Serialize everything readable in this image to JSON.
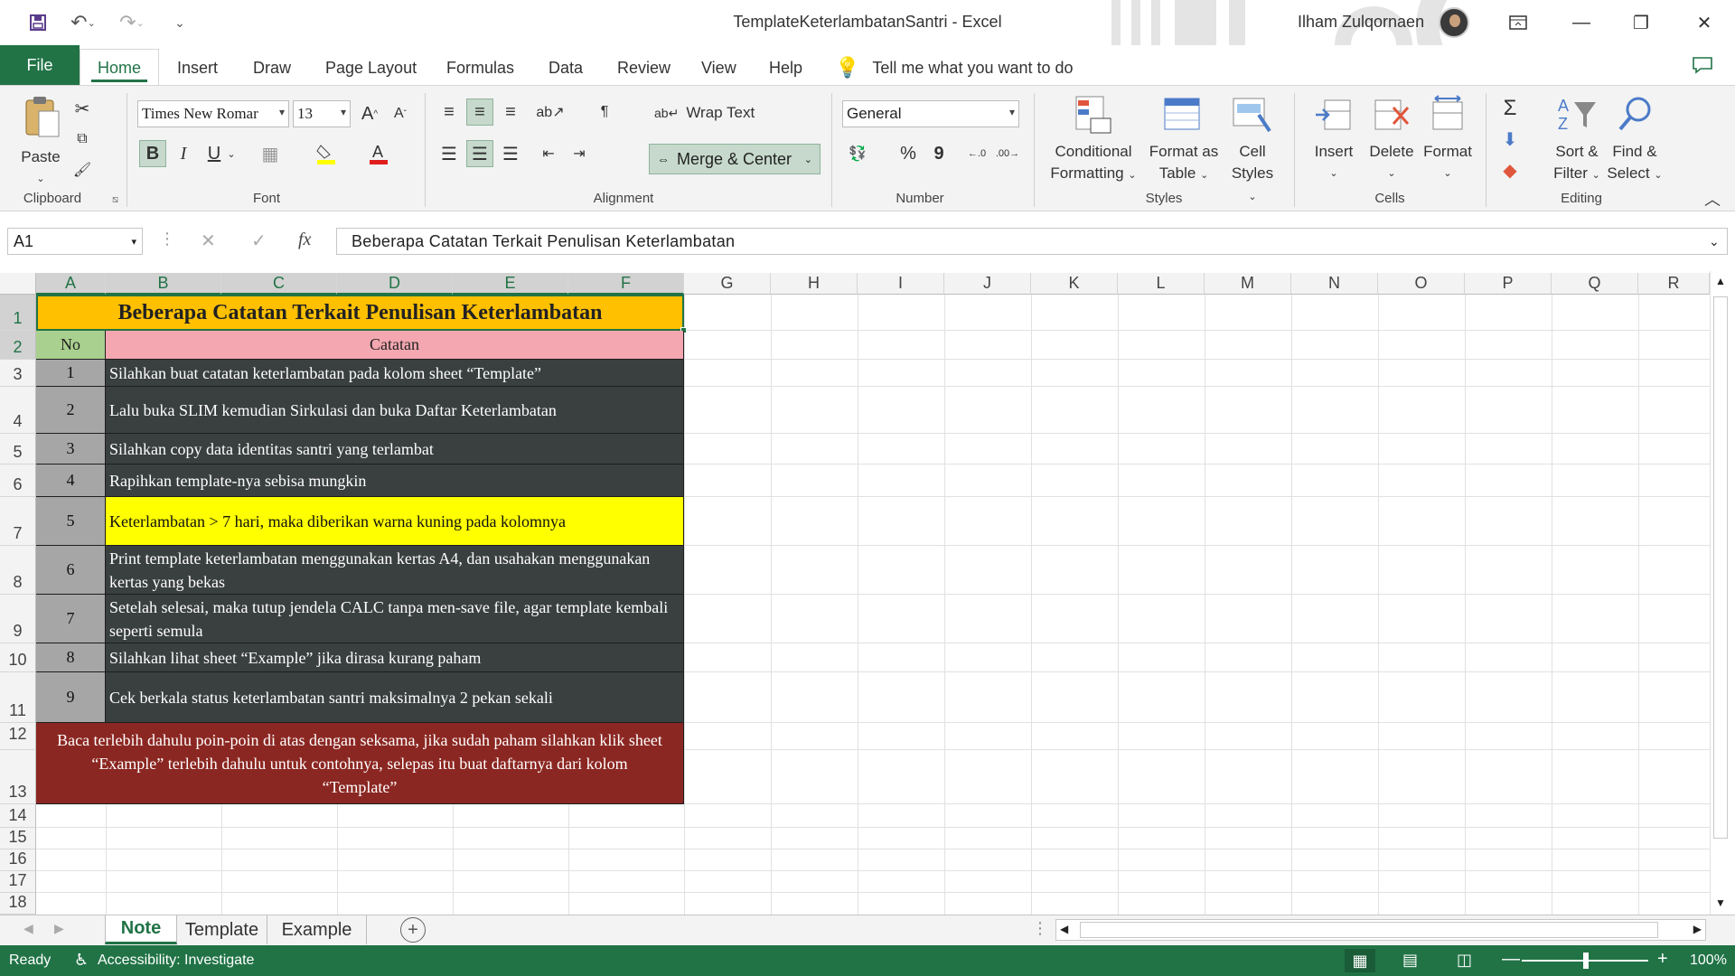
{
  "titlebar": {
    "title": "TemplateKeterlambatanSantri  -  Excel",
    "user": "Ilham Zulqornaen",
    "save_icon": "save-icon",
    "undo_icon": "undo-icon",
    "redo_icon": "redo-icon"
  },
  "tabs": [
    "File",
    "Home",
    "Insert",
    "Draw",
    "Page Layout",
    "Formulas",
    "Data",
    "Review",
    "View",
    "Help"
  ],
  "tell_me": "Tell me what you want to do",
  "ribbon": {
    "clipboard": {
      "paste": "Paste",
      "label": "Clipboard"
    },
    "font": {
      "name": "Times New Romar",
      "size": "13",
      "label": "Font",
      "bold": "B",
      "italic": "I",
      "underline": "U"
    },
    "alignment": {
      "wrap": "Wrap Text",
      "merge": "Merge & Center",
      "label": "Alignment"
    },
    "number": {
      "format": "General",
      "label": "Number",
      "percent": "%",
      "comma": "9"
    },
    "styles": {
      "conditional": "Conditional",
      "conditional2": "Formatting",
      "format_table": "Format as",
      "format_table2": "Table",
      "cell_styles": "Cell",
      "cell_styles2": "Styles",
      "label": "Styles"
    },
    "cells": {
      "insert": "Insert",
      "delete": "Delete",
      "format": "Format",
      "label": "Cells"
    },
    "editing": {
      "sort": "Sort &",
      "sort2": "Filter",
      "find": "Find &",
      "find2": "Select",
      "label": "Editing"
    }
  },
  "formula_bar": {
    "name_box": "A1",
    "fx": "fx",
    "content": "Beberapa Catatan Terkait Penulisan Keterlambatan"
  },
  "columns": [
    "A",
    "B",
    "C",
    "D",
    "E",
    "F",
    "G",
    "H",
    "I",
    "J",
    "K",
    "L",
    "M",
    "N",
    "O",
    "P",
    "Q",
    "R"
  ],
  "rows": [
    "1",
    "2",
    "3",
    "4",
    "5",
    "6",
    "7",
    "8",
    "9",
    "10",
    "11",
    "12",
    "13",
    "14",
    "15",
    "16",
    "17",
    "18"
  ],
  "sheet": {
    "title": "Beberapa Catatan Terkait Penulisan Keterlambatan",
    "header_no": "No",
    "header_note": "Catatan",
    "notes": [
      {
        "no": "1",
        "text": "Silahkan buat catatan keterlambatan pada kolom sheet “Template”"
      },
      {
        "no": "2",
        "text": "Lalu buka SLIM kemudian Sirkulasi dan buka Daftar Keterlambatan"
      },
      {
        "no": "3",
        "text": "Silahkan copy data identitas santri yang terlambat"
      },
      {
        "no": "4",
        "text": "Rapihkan template-nya sebisa mungkin"
      },
      {
        "no": "5",
        "text": "Keterlambatan > 7 hari, maka diberikan warna kuning pada kolomnya"
      },
      {
        "no": "6",
        "text": "Print template keterlambatan menggunakan kertas A4, dan usahakan menggunakan kertas yang bekas"
      },
      {
        "no": "7",
        "text": "Setelah selesai, maka tutup jendela CALC tanpa men-save file, agar template kembali seperti semula"
      },
      {
        "no": "8",
        "text": "Silahkan lihat sheet “Example” jika dirasa kurang paham"
      },
      {
        "no": "9",
        "text": "Cek berkala status keterlambatan santri maksimalnya 2 pekan sekali"
      }
    ],
    "footer": "Baca terlebih dahulu poin-poin di atas dengan seksama, jika sudah paham silahkan klik sheet “Example” terlebih dahulu untuk contohnya, selepas itu buat daftarnya dari kolom “Template”"
  },
  "sheet_tabs": [
    "Note",
    "Template",
    "Example"
  ],
  "status": {
    "ready": "Ready",
    "accessibility": "Accessibility: Investigate",
    "zoom": "100%"
  },
  "colors": {
    "excel_green": "#217346",
    "title_fill": "#ffc000",
    "no_header_fill": "#a9d08e",
    "note_header_fill": "#f4a7b0",
    "number_fill": "#a6a6a6",
    "note_fill": "#3a3f40",
    "highlight_fill": "#ffff00",
    "footer_fill": "#8b2722"
  }
}
